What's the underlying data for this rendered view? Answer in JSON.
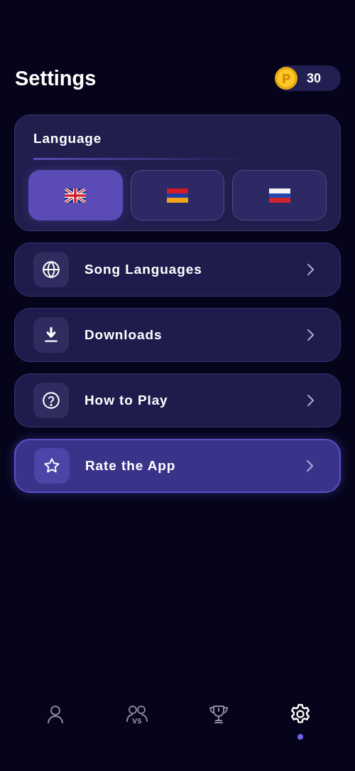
{
  "header": {
    "title": "Settings",
    "coins": {
      "symbol": "P",
      "amount": "30"
    }
  },
  "language_card": {
    "title": "Language",
    "options": [
      {
        "kind": "uk",
        "selected": true
      },
      {
        "kind": "armenia",
        "selected": false
      },
      {
        "kind": "russia",
        "selected": false
      }
    ]
  },
  "menu": [
    {
      "kind": "globe",
      "label": "Song Languages",
      "selected": false
    },
    {
      "kind": "download",
      "label": "Downloads",
      "selected": false
    },
    {
      "kind": "help",
      "label": "How to Play",
      "selected": false
    },
    {
      "kind": "star",
      "label": "Rate the App",
      "selected": true
    }
  ],
  "tab_bar": [
    {
      "kind": "profile",
      "selected": false
    },
    {
      "kind": "versus",
      "badge": "VS",
      "selected": false
    },
    {
      "kind": "trophy",
      "selected": false
    },
    {
      "kind": "settings",
      "selected": true
    }
  ]
}
